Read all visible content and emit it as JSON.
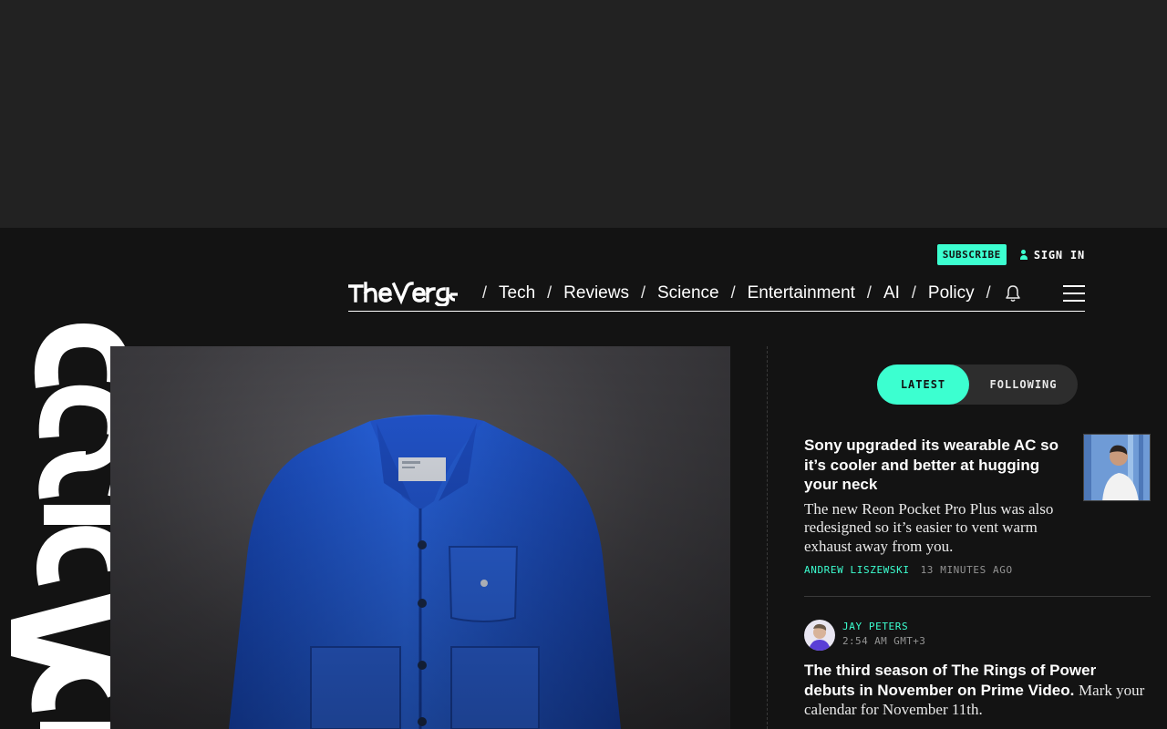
{
  "brand": {
    "name": "The Verge",
    "accent": "#3cffd0",
    "background": "#131313"
  },
  "utility": {
    "subscribe_label": "SUBSCRIBE",
    "signin_label": "SIGN IN"
  },
  "nav": {
    "items": [
      "Tech",
      "Reviews",
      "Science",
      "Entertainment",
      "AI",
      "Policy"
    ],
    "separator": "/",
    "icons": [
      "bell-icon",
      "hamburger-menu-icon"
    ]
  },
  "feed": {
    "tabs": {
      "latest": "LATEST",
      "following": "FOLLOWING",
      "active": "LATEST"
    },
    "stories": [
      {
        "title": "Sony upgraded its wearable AC so it’s cooler and better at hugging your neck",
        "dek": "The new Reon Pocket Pro Plus was also redesigned so it’s easier to vent warm exhaust away from you.",
        "author": "ANDREW LISZEWSKI",
        "time": "13 MINUTES AGO"
      },
      {
        "author": "JAY PETERS",
        "time": "2:54 AM GMT+3",
        "headline": "The third season of The Rings of Power debuts in November on Prime Video.",
        "text": "Mark your calendar for November 11th."
      }
    ]
  }
}
